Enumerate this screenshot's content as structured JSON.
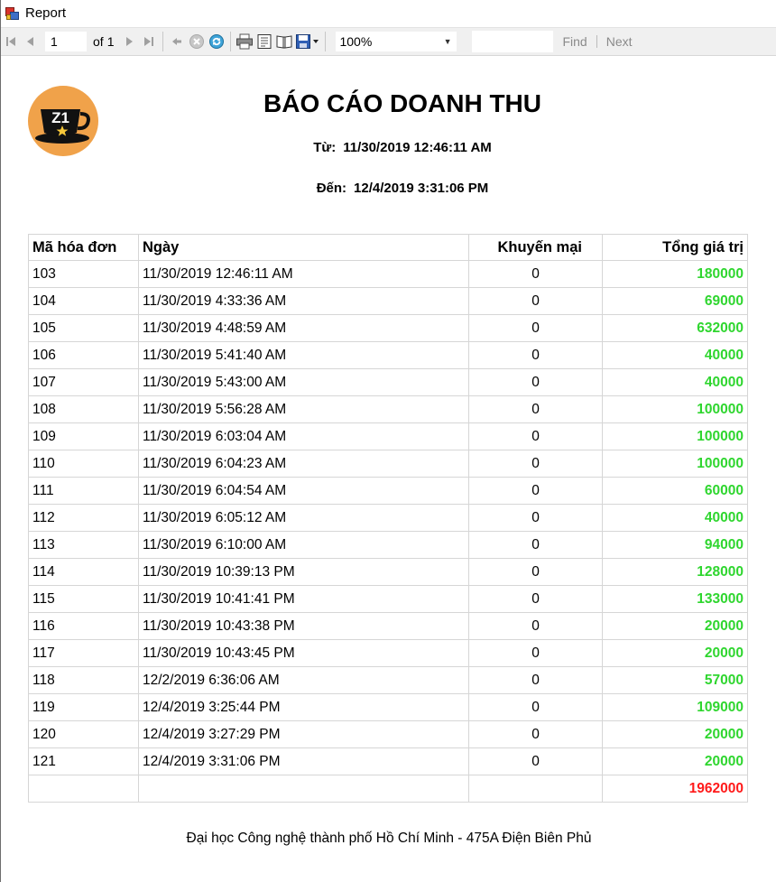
{
  "window": {
    "title": "Report"
  },
  "toolbar": {
    "page_current": "1",
    "page_of_label": "of",
    "page_total": "1",
    "zoom": "100%",
    "find_label": "Find",
    "next_label": "Next"
  },
  "report": {
    "title": "BÁO CÁO DOANH THU",
    "from_label": "Từ:",
    "from_value": "11/30/2019 12:46:11 AM",
    "to_label": "Đến:",
    "to_value": "12/4/2019 3:31:06 PM",
    "logo_text": "Z1",
    "columns": [
      "Mã hóa đơn",
      "Ngày",
      "Khuyến mại",
      "Tổng giá trị"
    ],
    "rows": [
      {
        "id": "103",
        "date": "11/30/2019 12:46:11 AM",
        "promo": "0",
        "total": "180000"
      },
      {
        "id": "104",
        "date": "11/30/2019 4:33:36 AM",
        "promo": "0",
        "total": "69000"
      },
      {
        "id": "105",
        "date": "11/30/2019 4:48:59 AM",
        "promo": "0",
        "total": "632000"
      },
      {
        "id": "106",
        "date": "11/30/2019 5:41:40 AM",
        "promo": "0",
        "total": "40000"
      },
      {
        "id": "107",
        "date": "11/30/2019 5:43:00 AM",
        "promo": "0",
        "total": "40000"
      },
      {
        "id": "108",
        "date": "11/30/2019 5:56:28 AM",
        "promo": "0",
        "total": "100000"
      },
      {
        "id": "109",
        "date": "11/30/2019 6:03:04 AM",
        "promo": "0",
        "total": "100000"
      },
      {
        "id": "110",
        "date": "11/30/2019 6:04:23 AM",
        "promo": "0",
        "total": "100000"
      },
      {
        "id": "111",
        "date": "11/30/2019 6:04:54 AM",
        "promo": "0",
        "total": "60000"
      },
      {
        "id": "112",
        "date": "11/30/2019 6:05:12 AM",
        "promo": "0",
        "total": "40000"
      },
      {
        "id": "113",
        "date": "11/30/2019 6:10:00 AM",
        "promo": "0",
        "total": "94000"
      },
      {
        "id": "114",
        "date": "11/30/2019 10:39:13 PM",
        "promo": "0",
        "total": "128000"
      },
      {
        "id": "115",
        "date": "11/30/2019 10:41:41 PM",
        "promo": "0",
        "total": "133000"
      },
      {
        "id": "116",
        "date": "11/30/2019 10:43:38 PM",
        "promo": "0",
        "total": "20000"
      },
      {
        "id": "117",
        "date": "11/30/2019 10:43:45 PM",
        "promo": "0",
        "total": "20000"
      },
      {
        "id": "118",
        "date": "12/2/2019 6:36:06 AM",
        "promo": "0",
        "total": "57000"
      },
      {
        "id": "119",
        "date": "12/4/2019 3:25:44 PM",
        "promo": "0",
        "total": "109000"
      },
      {
        "id": "120",
        "date": "12/4/2019 3:27:29 PM",
        "promo": "0",
        "total": "20000"
      },
      {
        "id": "121",
        "date": "12/4/2019 3:31:06 PM",
        "promo": "0",
        "total": "20000"
      }
    ],
    "grand_total": "1962000",
    "footer": "Đại học Công nghệ thành phố Hồ Chí Minh - 475A Điện Biên Phủ"
  },
  "colors": {
    "total_value": "#2fd62f",
    "grand_total": "#ff1a1a",
    "logo_bg": "#f0a24a"
  },
  "icons": [
    "first-page-icon",
    "previous-page-icon",
    "next-page-icon",
    "last-page-icon",
    "back-icon",
    "stop-icon",
    "refresh-icon",
    "print-icon",
    "print-layout-icon",
    "page-setup-icon",
    "export-icon"
  ]
}
